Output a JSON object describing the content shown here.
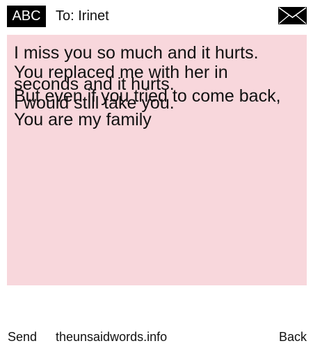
{
  "header": {
    "badge_label": "ABC",
    "recipient": "To: Irinet",
    "envelope_icon": "envelope-icon"
  },
  "message": {
    "background_color": "#f8d7dc",
    "lines": [
      "I miss you so much and it hurts.",
      "You replaced me with her in",
      "seconds and it hurts.",
      "But even if you tried to come back,",
      "I would still take you.",
      "You are my family"
    ]
  },
  "footer": {
    "send_label": "Send",
    "site_label": "theunsaidwords.info",
    "back_label": "Back"
  }
}
